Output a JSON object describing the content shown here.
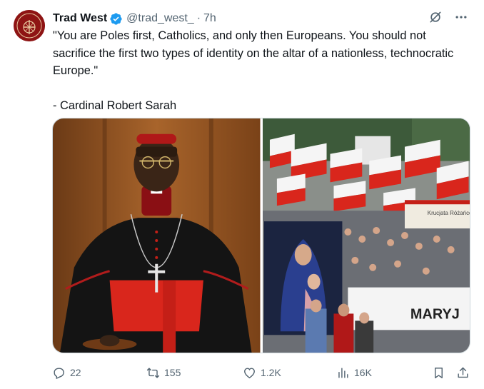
{
  "author": {
    "name": "Trad West",
    "handle": "@trad_west_",
    "time": "7h",
    "verified": true,
    "avatar_icon": "avatar-crest-icon"
  },
  "separator": "·",
  "tweet": {
    "lines": [
      "\"You are Poles first, Catholics, and only then Europeans. You should not sacrifice the first two types of identity on the altar of a nationless, technocratic Europe.\"",
      "- Cardinal Robert Sarah"
    ]
  },
  "media": {
    "images": [
      {
        "name": "cardinal-photo"
      },
      {
        "name": "march-crowd-photo",
        "banner_top": "Krucjata Różańcowa za Ojczyznę",
        "banner_bottom": "MARYJ"
      }
    ]
  },
  "actions": {
    "reply_count": "22",
    "retweet_count": "155",
    "like_count": "1.2K",
    "views_count": "16K"
  },
  "colors": {
    "text_primary": "#0f1419",
    "text_secondary": "#536471",
    "verified_blue": "#1d9bf0",
    "border": "#cfd9de"
  }
}
